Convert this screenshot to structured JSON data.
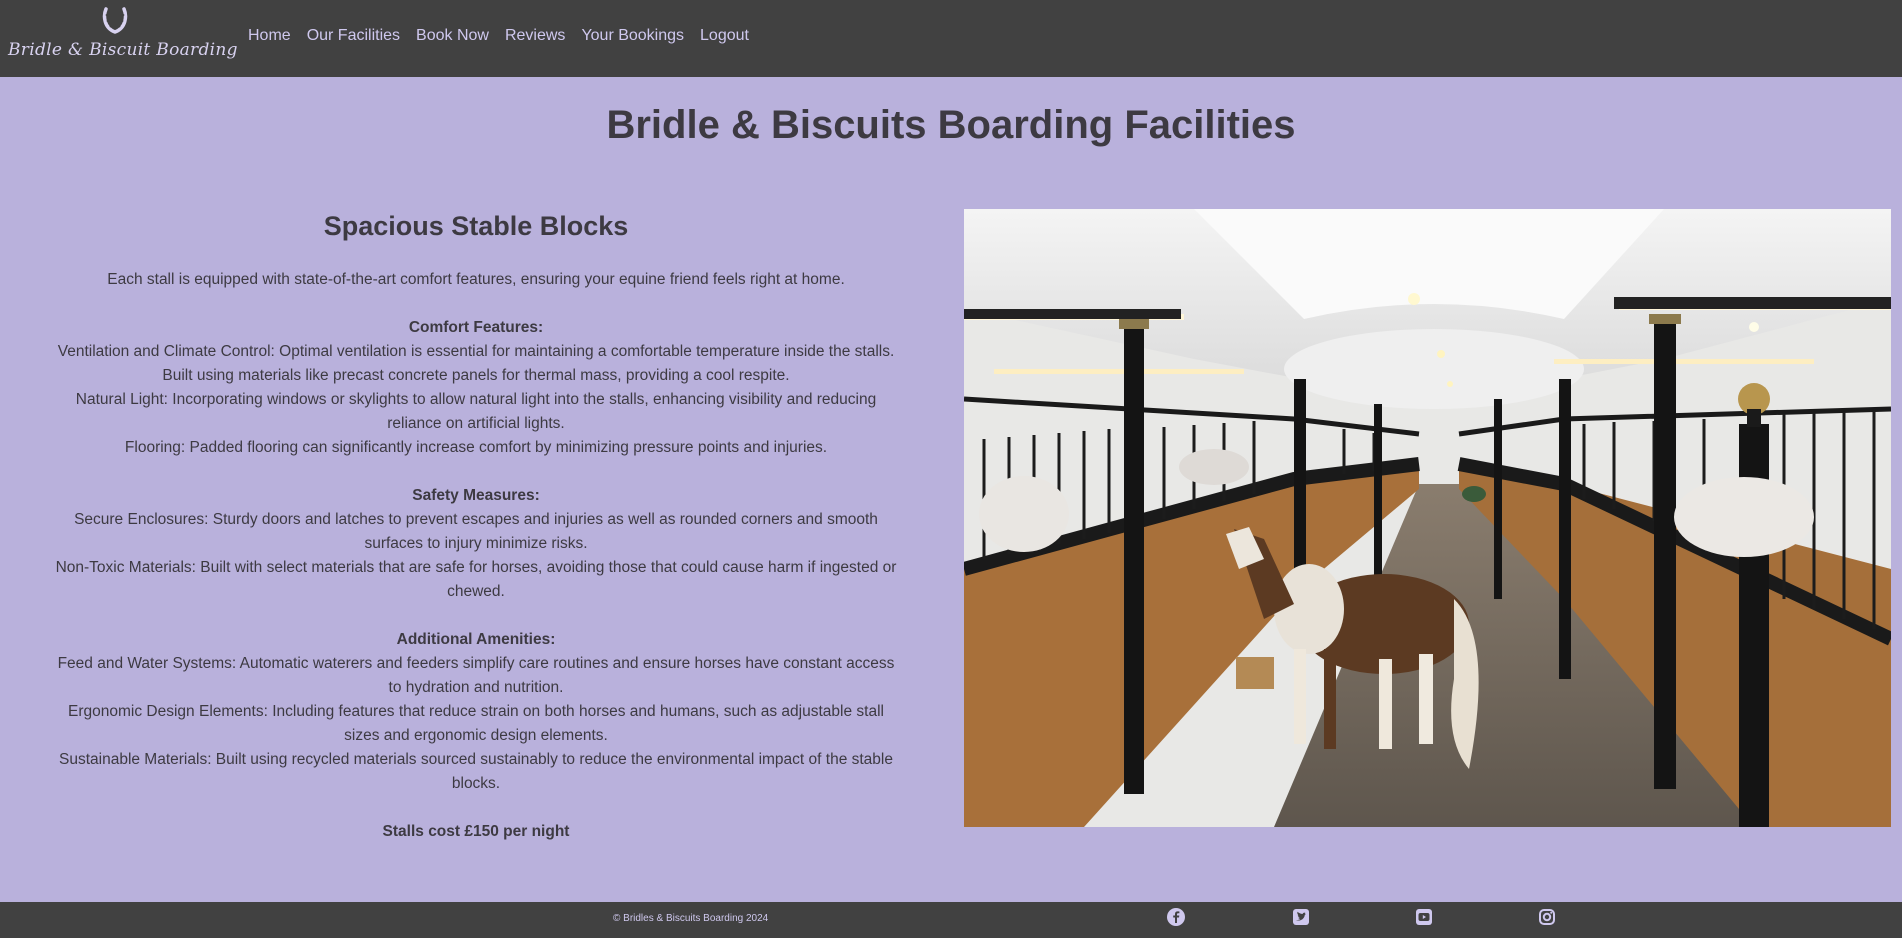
{
  "navbar": {
    "logo_text": "Bridle & Biscuit Boarding",
    "links": [
      "Home",
      "Our Facilities",
      "Book Now",
      "Reviews",
      "Your Bookings",
      "Logout"
    ]
  },
  "main": {
    "title": "Bridle & Biscuits Boarding Facilities",
    "section_title": "Spacious Stable Blocks",
    "intro": "Each stall is equipped with state-of-the-art comfort features, ensuring your equine friend feels right at home.",
    "comfort": {
      "heading": "Comfort Features:",
      "items": [
        "Ventilation and Climate Control: Optimal ventilation is essential for maintaining a comfortable temperature inside the stalls. Built using materials like precast concrete panels for thermal mass, providing a cool respite.",
        "Natural Light: Incorporating windows or skylights to allow natural light into the stalls, enhancing visibility and reducing reliance on artificial lights.",
        "Flooring: Padded flooring can significantly increase comfort by minimizing pressure points and injuries."
      ]
    },
    "safety": {
      "heading": "Safety Measures:",
      "items": [
        "Secure Enclosures: Sturdy doors and latches to prevent escapes and injuries as well as rounded corners and smooth surfaces to injury minimize risks.",
        "Non-Toxic Materials: Built with select materials that are safe for horses, avoiding those that could cause harm if ingested or chewed."
      ]
    },
    "amenities": {
      "heading": "Additional Amenities:",
      "items": [
        "Feed and Water Systems: Automatic waterers and feeders simplify care routines and ensure horses have constant access to hydration and nutrition.",
        "Ergonomic Design Elements: Including features that reduce strain on both horses and humans, such as adjustable stall sizes and ergonomic design elements.",
        "Sustainable Materials: Built using recycled materials sourced sustainably to reduce the environmental impact of the stable blocks."
      ]
    },
    "price": "Stalls cost £150 per night"
  },
  "footer": {
    "copyright": "© Bridles & Biscuits Boarding 2024",
    "social": [
      "facebook-icon",
      "twitter-icon",
      "youtube-icon",
      "instagram-icon"
    ]
  },
  "colors": {
    "background": "#b9b1dc",
    "navbar": "#414141",
    "nav_text": "#cfc8ee",
    "body_text": "#3d3a42"
  }
}
